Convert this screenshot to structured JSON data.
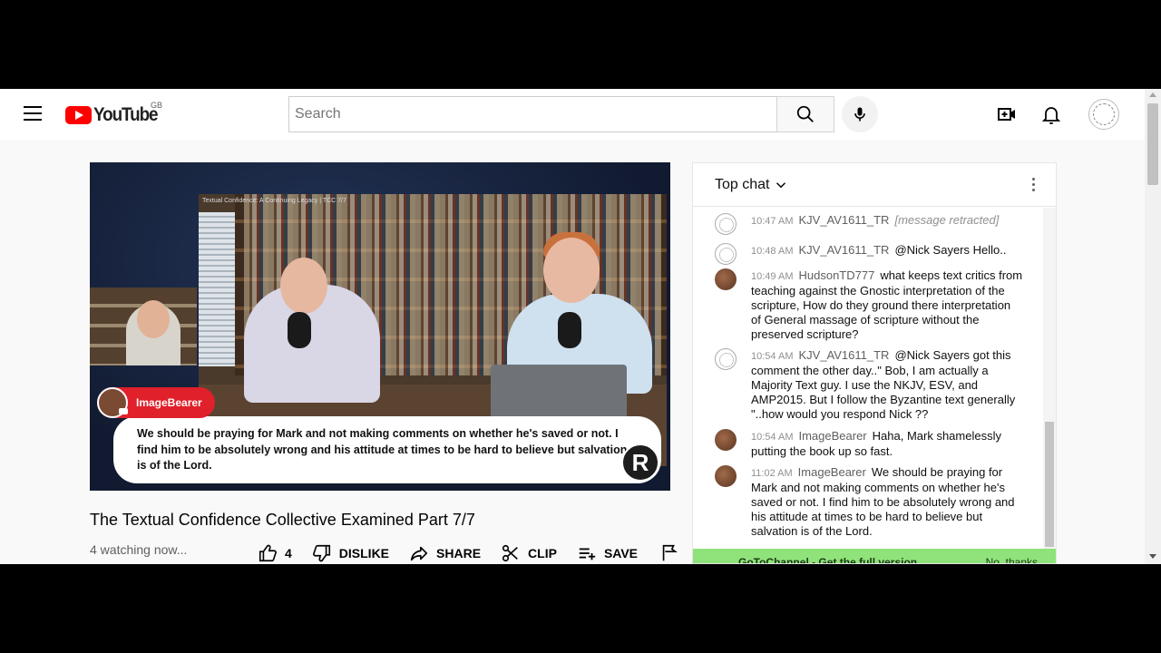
{
  "header": {
    "logo_text": "YouTube",
    "region": "GB",
    "search_placeholder": "Search"
  },
  "video": {
    "inner_title": "Textual Confidence: A Continuing Legacy | TCC 7/7",
    "overlay_name": "ImageBearer",
    "overlay_text": "We should be praying for Mark and not making comments on whether he's saved or not. I find him to be absolutely wrong and his attitude at times to be hard to believe but salvation is of the Lord.",
    "title": "The Textual Confidence Collective Examined Part 7/7",
    "watching": "4 watching now...",
    "actions": {
      "like_count": "4",
      "dislike": "DISLIKE",
      "share": "SHARE",
      "clip": "CLIP",
      "save": "SAVE"
    }
  },
  "chat": {
    "header": "Top chat",
    "messages": [
      {
        "time": "10:47 AM",
        "author": "KJV_AV1611_TR",
        "text": "[message retracted]"
      },
      {
        "time": "10:48 AM",
        "author": "KJV_AV1611_TR",
        "text": "@Nick Sayers Hello.."
      },
      {
        "time": "10:49 AM",
        "author": "HudsonTD777",
        "text": "what keeps text critics from teaching against the Gnostic interpretation of the scripture, How do they ground there interpretation of General massage of scripture without the preserved scripture?"
      },
      {
        "time": "10:54 AM",
        "author": "KJV_AV1611_TR",
        "text": "@Nick Sayers got this comment the other day..\" Bob, I am actually a Majority Text guy. I use the NKJV, ESV, and AMP2015. But I follow the Byzantine text generally \"..how would you respond Nick ??"
      },
      {
        "time": "10:54 AM",
        "author": "ImageBearer",
        "text": "Haha, Mark shamelessly putting the book up so fast."
      },
      {
        "time": "11:02 AM",
        "author": "ImageBearer",
        "text": "We should be praying for Mark and not making comments on whether he's saved or not. I find him to be absolutely wrong and his attitude at times to be hard to believe but salvation is of the Lord."
      }
    ],
    "banner_text": "GoToChannel - Get the full version",
    "banner_dismiss": "No, thanks"
  }
}
